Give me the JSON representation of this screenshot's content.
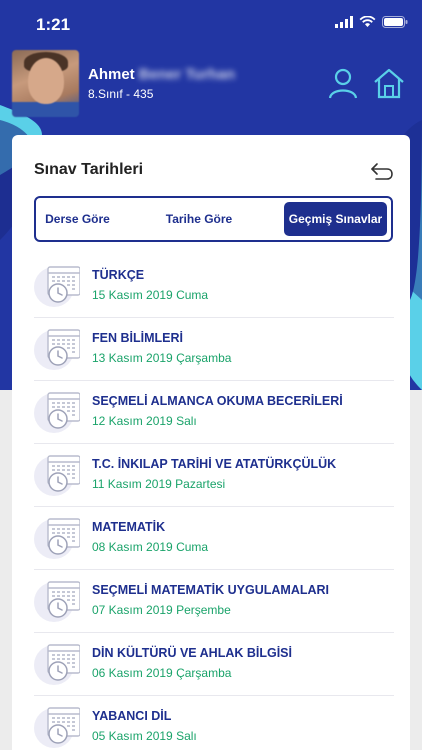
{
  "status": {
    "time": "1:21"
  },
  "profile": {
    "first_name": "Ahmet",
    "last_name_blurred": "Bener Turhan",
    "class_info": "8.Sınıf - 435"
  },
  "header_icons": [
    "user-icon",
    "home-icon"
  ],
  "card": {
    "title": "Sınav Tarihleri",
    "tabs": [
      {
        "label": "Derse Göre",
        "active": false
      },
      {
        "label": "Tarihe Göre",
        "active": false
      },
      {
        "label": "Geçmiş Sınavlar",
        "active": true
      }
    ]
  },
  "exams": [
    {
      "name": "TÜRKÇE",
      "date": "15 Kasım 2019",
      "day": "Cuma"
    },
    {
      "name": "FEN BİLİMLERİ",
      "date": "13 Kasım 2019",
      "day": "Çarşamba"
    },
    {
      "name": "SEÇMELİ ALMANCA OKUMA BECERİLERİ",
      "date": "12 Kasım 2019",
      "day": "Salı"
    },
    {
      "name": "T.C. İNKILAP TARİHİ VE ATATÜRKÇÜLÜK",
      "date": "11 Kasım 2019",
      "day": "Pazartesi"
    },
    {
      "name": "MATEMATİK",
      "date": "08 Kasım 2019",
      "day": "Cuma"
    },
    {
      "name": "SEÇMELİ MATEMATİK UYGULAMALARI",
      "date": "07 Kasım 2019",
      "day": "Perşembe"
    },
    {
      "name": "DİN KÜLTÜRÜ VE AHLAK BİLGİSİ",
      "date": "06 Kasım 2019",
      "day": "Çarşamba"
    },
    {
      "name": "YABANCI DİL",
      "date": "05 Kasım 2019",
      "day": "Salı"
    }
  ],
  "colors": {
    "primary": "#1e2f8e",
    "header_bg": "#2236a3",
    "accent_cyan": "#5ad0e8",
    "date_green": "#1aa36a"
  }
}
